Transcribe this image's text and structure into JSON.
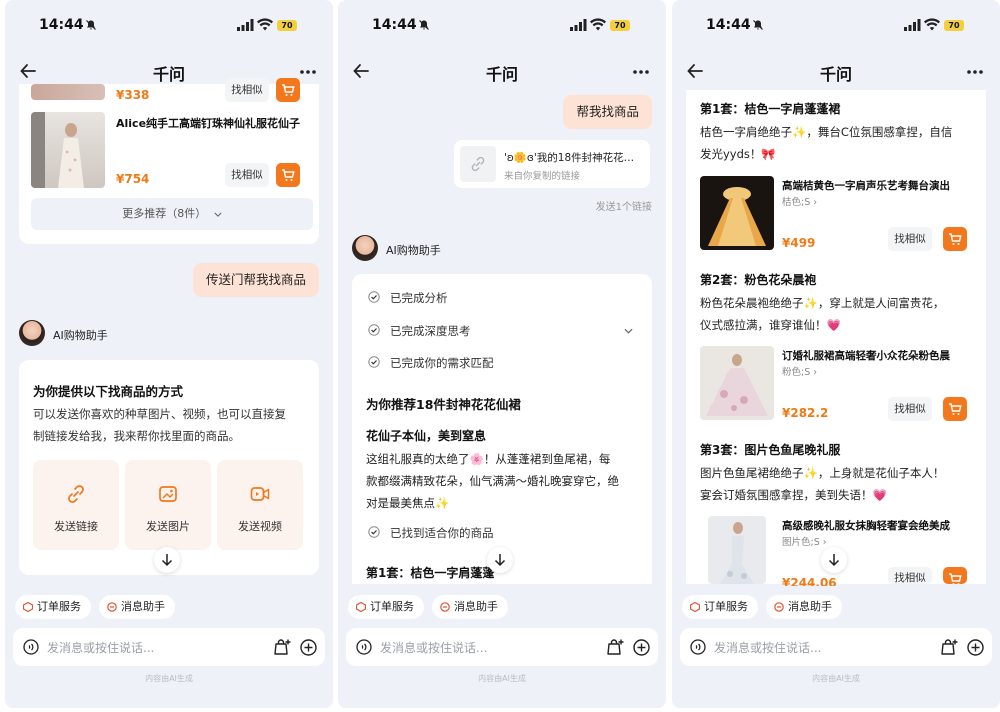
{
  "status": {
    "time": "14:44",
    "battery": "70"
  },
  "header": {
    "title": "千问"
  },
  "screen1": {
    "price_top": "¥338",
    "find_similar_top": "找相似",
    "product": {
      "title": "Alice纯手工高端钉珠神仙礼服花仙子",
      "price": "¥754",
      "find_similar": "找相似"
    },
    "more_recommend": "更多推荐（8件）",
    "user_message": "传送门帮我找商品",
    "assistant_name": "AI购物助手",
    "methods_title": "为你提供以下找商品的方式",
    "methods_desc_line1": "可以发送你喜欢的种草图片、视频，也可以直接复",
    "methods_desc_line2": "制链接发给我，我来帮你找里面的商品。",
    "options": [
      {
        "label": "发送链接",
        "icon": "link-icon"
      },
      {
        "label": "发送图片",
        "icon": "image-icon"
      },
      {
        "label": "发送视频",
        "icon": "video-icon"
      }
    ]
  },
  "screen2": {
    "user_message": "帮我找商品",
    "link_card": {
      "title": "'ʚ🌼ɞ'我的18件封神花花…",
      "subtitle": "来自你复制的链接"
    },
    "link_status": "发送1个链接",
    "assistant_name": "AI购物助手",
    "steps": [
      "已完成分析",
      "已完成深度思考",
      "已完成你的需求匹配"
    ],
    "heading": "为你推荐18件封神花花仙裙",
    "subheading": "花仙子本仙，美到窒息",
    "body_line1": "这组礼服真的太绝了🌸！从蓬蓬裙到鱼尾裙，每",
    "body_line2": "款都缀满精致花朵，仙气满满～婚礼晚宴穿它，绝",
    "body_line3": "对是最美焦点✨",
    "found_step": "已找到适合你的商品",
    "set1_partial": "第1套：桔色一字肩蓬蓬"
  },
  "screen3": {
    "sets": [
      {
        "heading": "第1套：桔色一字肩蓬蓬裙",
        "desc_line1": "桔色一字肩绝绝子✨，舞台C位氛围感拿捏，自信",
        "desc_line2": "发光yyds！🎀",
        "product_title": "高端桔黄色一字肩声乐艺考舞台演出",
        "spec": "桔色;S ›",
        "price": "¥499",
        "find_similar": "找相似"
      },
      {
        "heading": "第2套：粉色花朵晨袍",
        "desc_line1": "粉色花朵晨袍绝绝子✨，穿上就是人间富贵花，",
        "desc_line2": "仪式感拉满，谁穿谁仙！💗",
        "product_title": "订婚礼服裙高端轻奢小众花朵粉色晨",
        "spec": "粉色;S ›",
        "price": "¥282.2",
        "find_similar": "找相似"
      },
      {
        "heading": "第3套：图片色鱼尾晚礼服",
        "desc_line1": "图片色鱼尾裙绝绝子✨，上身就是花仙子本人！",
        "desc_line2": "宴会订婚氛围感拿捏，美到失语！💗",
        "product_title": "高级感晚礼服女抹胸轻奢宴会绝美成",
        "spec": "图片色;S ›",
        "price": "¥244.06",
        "find_similar": "找相似"
      }
    ]
  },
  "common": {
    "chip_order": "订单服务",
    "chip_messages": "消息助手",
    "input_placeholder": "发消息或按住说话...",
    "footer": "内容由AI生成"
  },
  "colors": {
    "accent": "#f3781d",
    "price": "#f07a16",
    "user_bubble": "#fde3d5",
    "background": "#eef2f8"
  }
}
